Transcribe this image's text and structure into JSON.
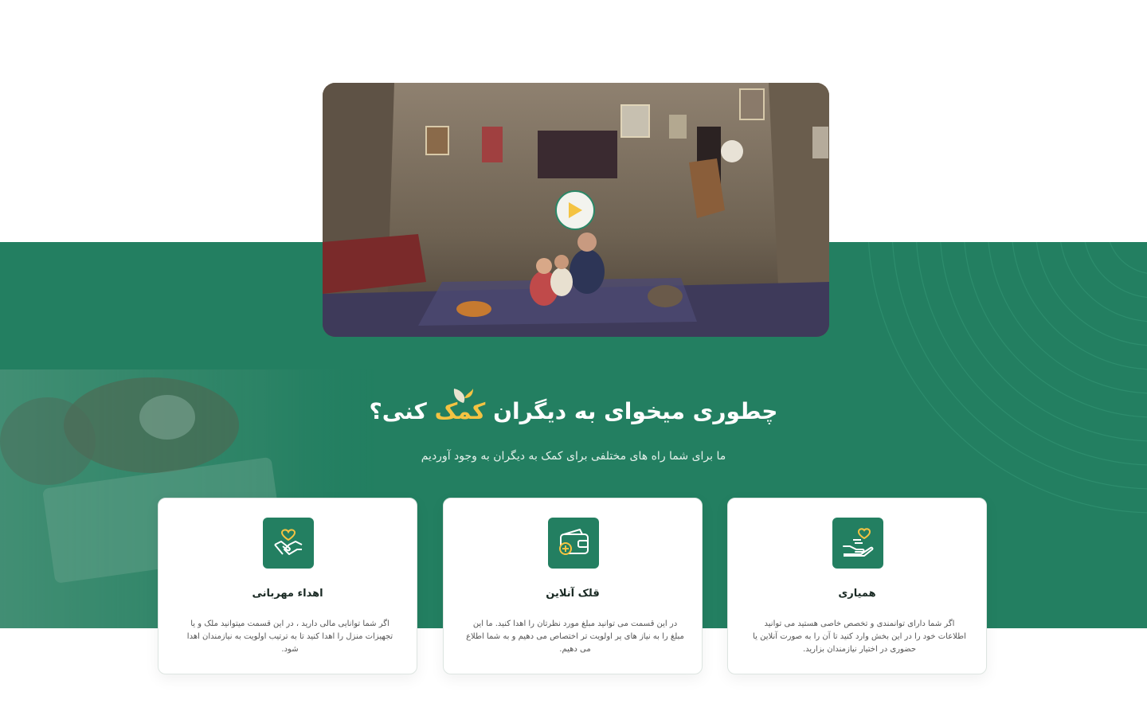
{
  "hero": {
    "video_alt": "Family sitting in a modest room",
    "play_label": ""
  },
  "section": {
    "title_before": "چطوری میخوای به دیگران",
    "title_accent": "کمک",
    "title_after": "کنی؟",
    "subtitle": "ما برای شما راه های مختلفی برای کمک به دیگران به وجود آوردیم"
  },
  "cards": [
    {
      "title": "همیاری",
      "text": "اگر شما دارای توانمندی و تخصص خاصی هستید می توانید اطلاعات خود را در این بخش وارد کنید تا آن را به صورت آنلاین یا حضوری در اختیار نیازمندان بزارید.",
      "icon": "hand-heart-icon"
    },
    {
      "title": "قلک آنلاین",
      "text": "در این قسمت می توانید مبلغ مورد نظرتان را اهدا کنید. ما این مبلغ را به نیاز های پر اولویت تر اختصاص می دهیم و به شما اطلاع می دهیم.",
      "icon": "wallet-plus-icon"
    },
    {
      "title": "اهداء مهربانی",
      "text": "اگر شما توانایی مالی دارید ، در این قسمت میتوانید ملک و یا تجهیزات منزل را اهدا کنید تا به ترتیب اولویت به نیازمندان اهدا شود.",
      "icon": "handshake-heart-icon"
    }
  ],
  "colors": {
    "brand_green": "#237f61",
    "accent_yellow": "#f4c342",
    "card_bg": "#ffffff"
  }
}
